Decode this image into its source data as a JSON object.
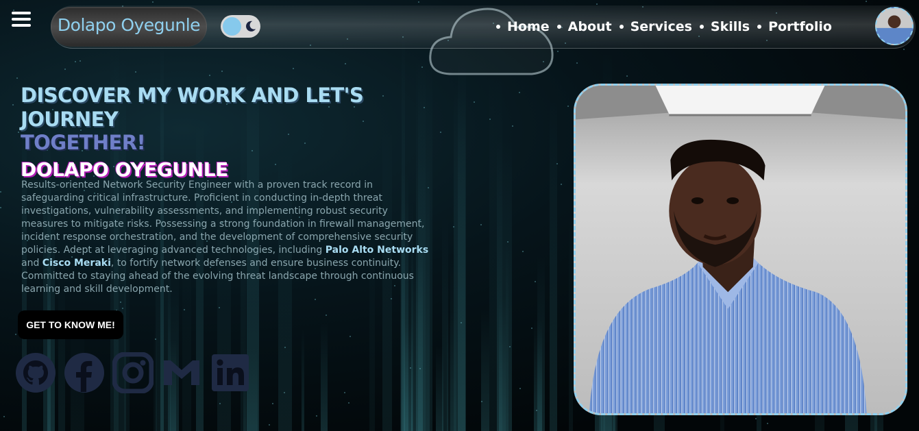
{
  "header": {
    "brand": "Dolapo Oyegunle",
    "nav": [
      {
        "label": "Home"
      },
      {
        "label": "About"
      },
      {
        "label": "Services"
      },
      {
        "label": "Skills"
      },
      {
        "label": "Portfolio"
      }
    ],
    "icons": {
      "menu": "hamburger-menu-icon",
      "theme_toggle": "moon-icon",
      "cloud": "cloud-icon"
    }
  },
  "hero": {
    "headline_line1": "DISCOVER MY WORK AND LET'S JOURNEY",
    "headline_line2": "TOGETHER!",
    "name": "DOLAPO OYEGUNLE",
    "bio_part1": "Results-oriented Network Security Engineer with a proven track record in safeguarding critical infrastructure. Proficient in conducting in-depth threat investigations, vulnerability assessments, and implementing robust security measures to mitigate risks. Possessing a strong foundation in firewall management, incident response orchestration, and the development of comprehensive security policies. Adept at leveraging advanced technologies, including ",
    "bio_highlight1": "Palo Alto Networks",
    "bio_part2": " and ",
    "bio_highlight2": "Cisco Meraki",
    "bio_part3": ", to fortify network defenses and ensure business continuity. Committed to staying ahead of the evolving threat landscape through continuous learning and skill development.",
    "cta_label": "GET TO KNOW ME!",
    "socials": [
      "github-icon",
      "facebook-icon",
      "instagram-icon",
      "gmail-icon",
      "linkedin-icon"
    ]
  },
  "colors": {
    "accent": "#8fd0ef",
    "headline": "#a9dcf2",
    "headline_secondary": "#6f7fc8",
    "name_shadow": "#b21bb6",
    "social_icon": "#1f2a44"
  }
}
